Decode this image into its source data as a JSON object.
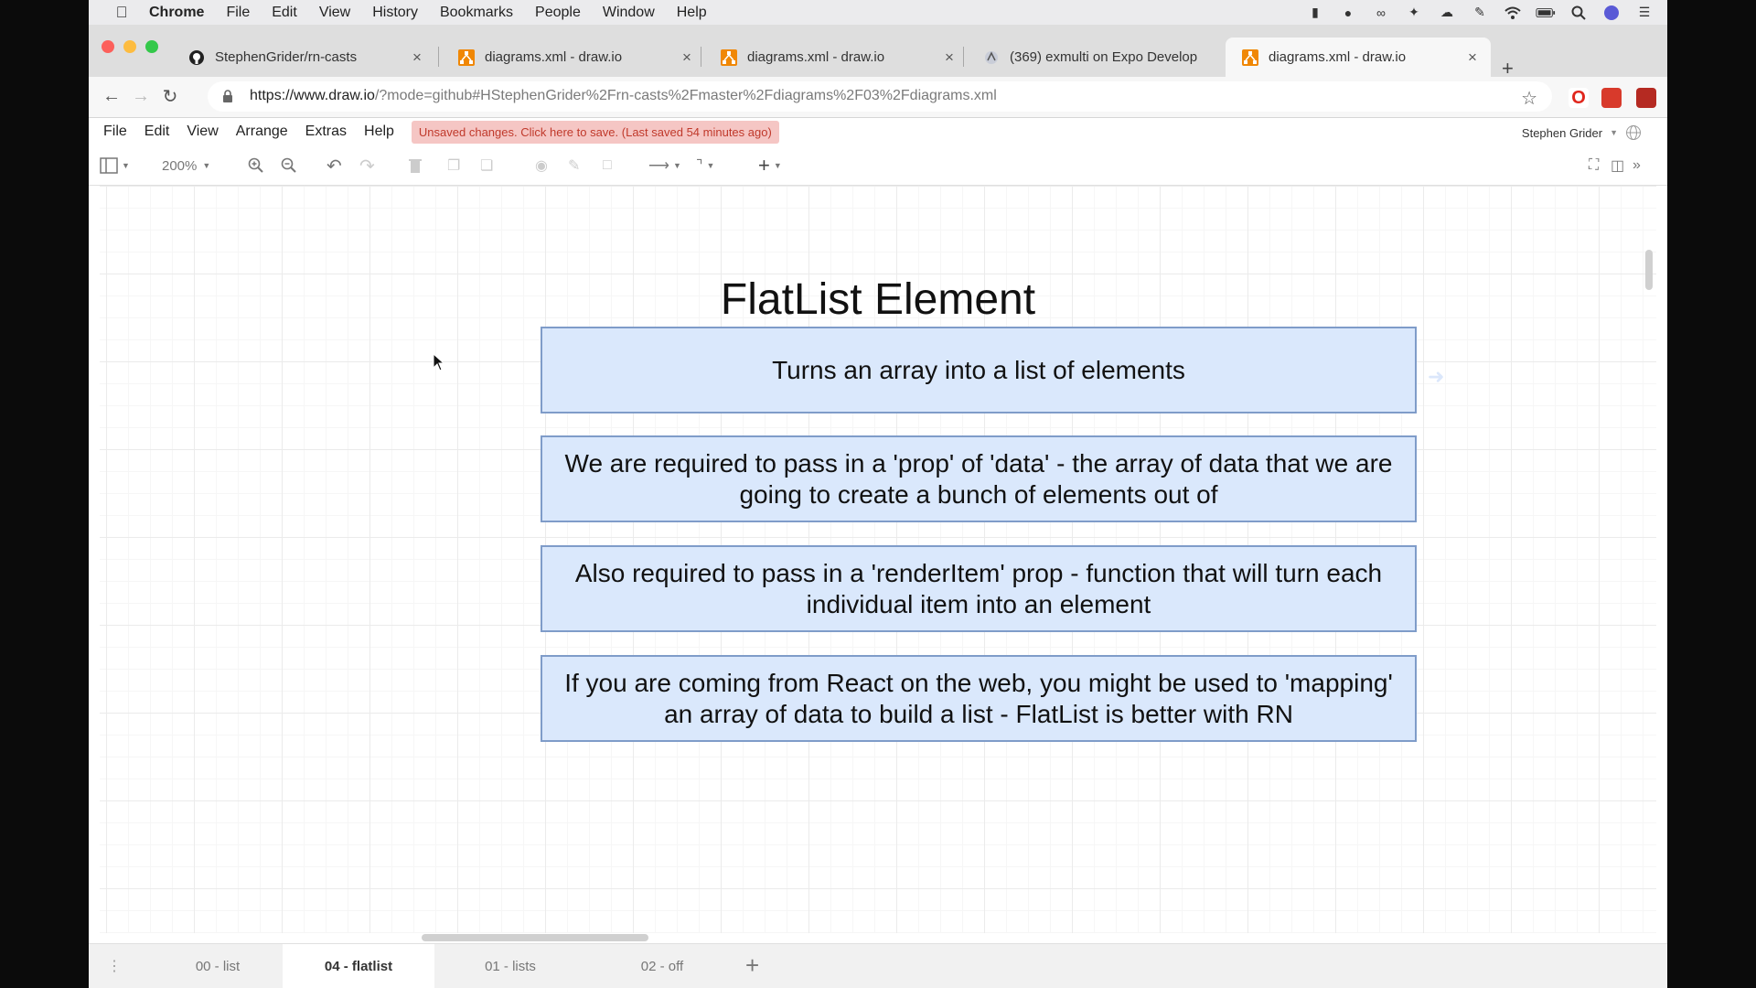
{
  "menubar": {
    "app": "Chrome",
    "items": [
      "File",
      "Edit",
      "View",
      "History",
      "Bookmarks",
      "People",
      "Window",
      "Help"
    ]
  },
  "tabs": [
    {
      "title": "StephenGrider/rn-casts",
      "icon": "github-icon"
    },
    {
      "title": "diagrams.xml - draw.io",
      "icon": "drawio-icon"
    },
    {
      "title": "diagrams.xml - draw.io",
      "icon": "drawio-icon"
    },
    {
      "title": "(369) exmulti on Expo Develop",
      "icon": "expo-icon"
    },
    {
      "title": "diagrams.xml - draw.io",
      "icon": "drawio-icon",
      "active": true
    }
  ],
  "address": {
    "domain": "https://www.draw.io",
    "path": "/?mode=github#HStephenGrider%2Frn-casts%2Fmaster%2Fdiagrams%2F03%2Fdiagrams.xml"
  },
  "drawio": {
    "menus": [
      "File",
      "Edit",
      "View",
      "Arrange",
      "Extras",
      "Help"
    ],
    "save_banner": "Unsaved changes. Click here to save. (Last saved 54 minutes ago)",
    "user": "Stephen Grider",
    "zoom": "200%"
  },
  "diagram": {
    "title": "FlatList Element",
    "boxes": [
      "Turns an array into a list of elements",
      "We are required to pass in a 'prop' of 'data' - the array of data that we are going to create a bunch of elements out of",
      "Also required to pass in a 'renderItem' prop - function that will turn each individual item into an element",
      "If you are coming from React on the web, you might be used to 'mapping' an array of data to build a list - FlatList is better with RN"
    ]
  },
  "pages": [
    "00 - list",
    "04 - flatlist",
    "01 - lists",
    "02 - off"
  ],
  "active_page": "04 - flatlist",
  "colors": {
    "box_fill": "#dae8fc",
    "box_border": "#7f9cc9",
    "banner_bg": "#f5c6c4",
    "banner_text": "#c0392b"
  }
}
